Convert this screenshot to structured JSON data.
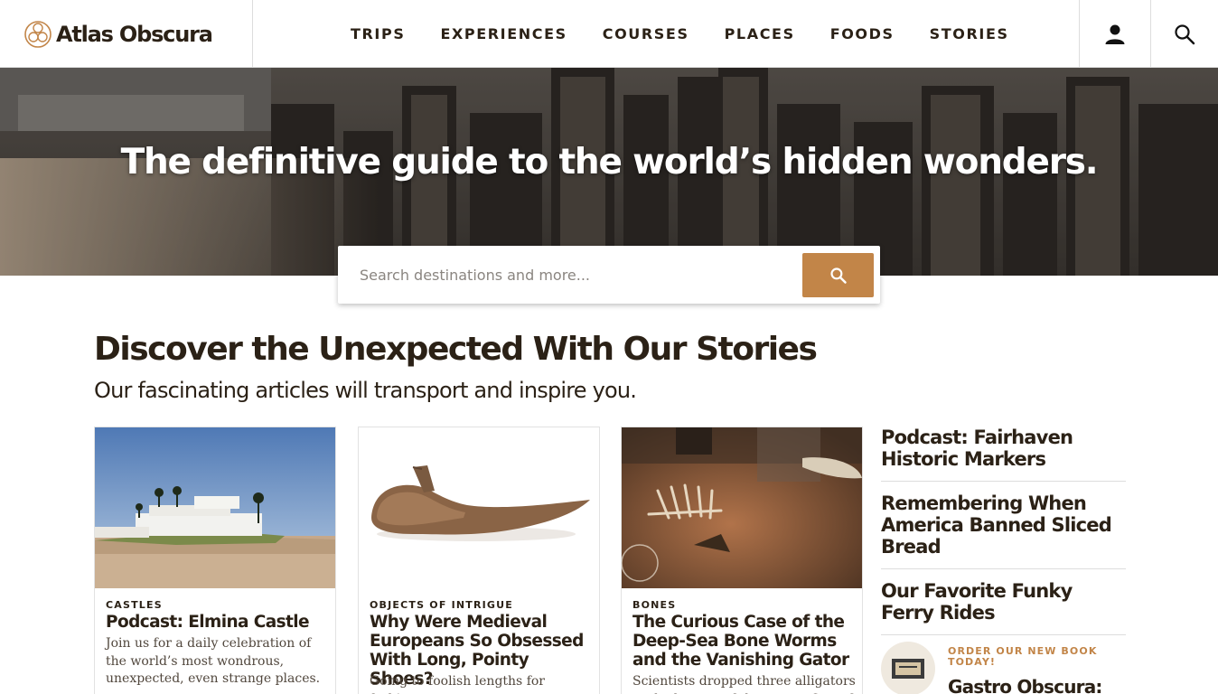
{
  "header": {
    "logo_text": "Atlas Obscura",
    "nav": [
      "TRIPS",
      "EXPERIENCES",
      "COURSES",
      "PLACES",
      "FOODS",
      "STORIES"
    ]
  },
  "hero": {
    "title": "The definitive guide to the world’s hidden wonders.",
    "search_placeholder": "Search destinations and more..."
  },
  "stories": {
    "title": "Discover the Unexpected With Our Stories",
    "subtitle": "Our fascinating articles will transport and inspire you.",
    "cards": [
      {
        "tag": "CASTLES",
        "title": "Podcast: Elmina Castle",
        "desc": "Join us for a daily celebration of the world’s most wondrous, unexpected, even strange places."
      },
      {
        "tag": "OBJECTS OF INTRIGUE",
        "title": "Why Were Medieval Europeans So Obsessed With Long, Pointy Shoes?",
        "desc": "Going to foolish lengths for fashion."
      },
      {
        "tag": "BONES",
        "title": "The Curious Case of the Deep-Sea Bone Worms and the Vanishing Gator",
        "desc": "Scientists dropped three alligators to the bottom of the ocean. One of"
      }
    ],
    "sidebar": [
      "Podcast: Fairhaven Historic Markers",
      "Remembering When America Banned Sliced Bread",
      "Our Favorite Funky Ferry Rides"
    ],
    "book": {
      "cta": "ORDER OUR NEW BOOK TODAY!",
      "title": "Gastro Obscura:"
    }
  },
  "colors": {
    "accent": "#c28548",
    "text": "#2b2116"
  },
  "icons": [
    "logo-icon",
    "user-icon",
    "search-icon",
    "magnifier-icon"
  ]
}
